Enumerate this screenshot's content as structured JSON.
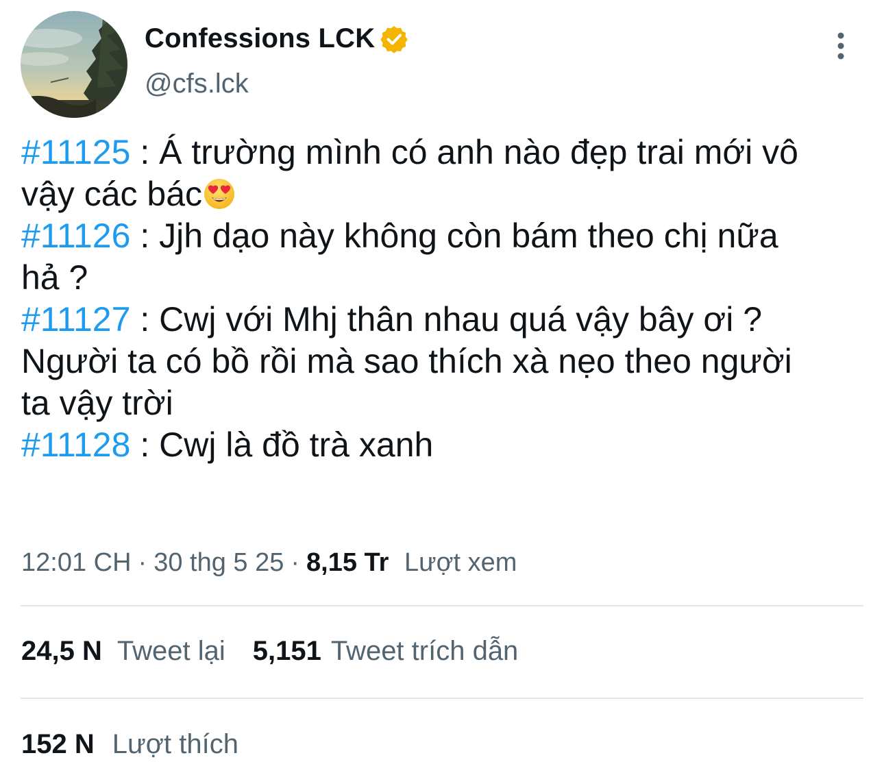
{
  "author": {
    "display_name": "Confessions LCK",
    "handle": "@cfs.lck",
    "verified_badge_icon": "verified-badge-icon",
    "badge_color": "#f4b400"
  },
  "tweet": {
    "lines": [
      {
        "hashtag": "#11125",
        "text": " : Á trường mình có anh nào đẹp trai mới vô"
      },
      {
        "hashtag": "",
        "text": "vậy các bác",
        "emoji": "heart-eyes-emoji"
      },
      {
        "hashtag": "#11126",
        "text": " : Jjh dạo này không còn bám theo chị nữa"
      },
      {
        "hashtag": "",
        "text": "hả ?"
      },
      {
        "hashtag": "#11127",
        "text": " : Cwj với Mhj thân nhau quá vậy bây ơi ?"
      },
      {
        "hashtag": "",
        "text": "Người ta có bồ rồi mà sao thích xà nẹo theo người"
      },
      {
        "hashtag": "",
        "text": "ta vậy trời"
      },
      {
        "hashtag": "#11128",
        "text": " : Cwj là đồ trà xanh"
      }
    ],
    "hashtag_color": "#1d9bf0"
  },
  "meta": {
    "time": "12:01 CH",
    "separator": "·",
    "date": "30 thg 5 25",
    "views_count": "8,15 Tr",
    "views_label": "Lượt xem"
  },
  "stats": {
    "retweets_count": "24,5 N",
    "retweets_label": "Tweet lại",
    "quotes_count": "5,151",
    "quotes_label": "Tweet trích dẫn",
    "likes_count": "152 N",
    "likes_label": "Lượt thích"
  }
}
